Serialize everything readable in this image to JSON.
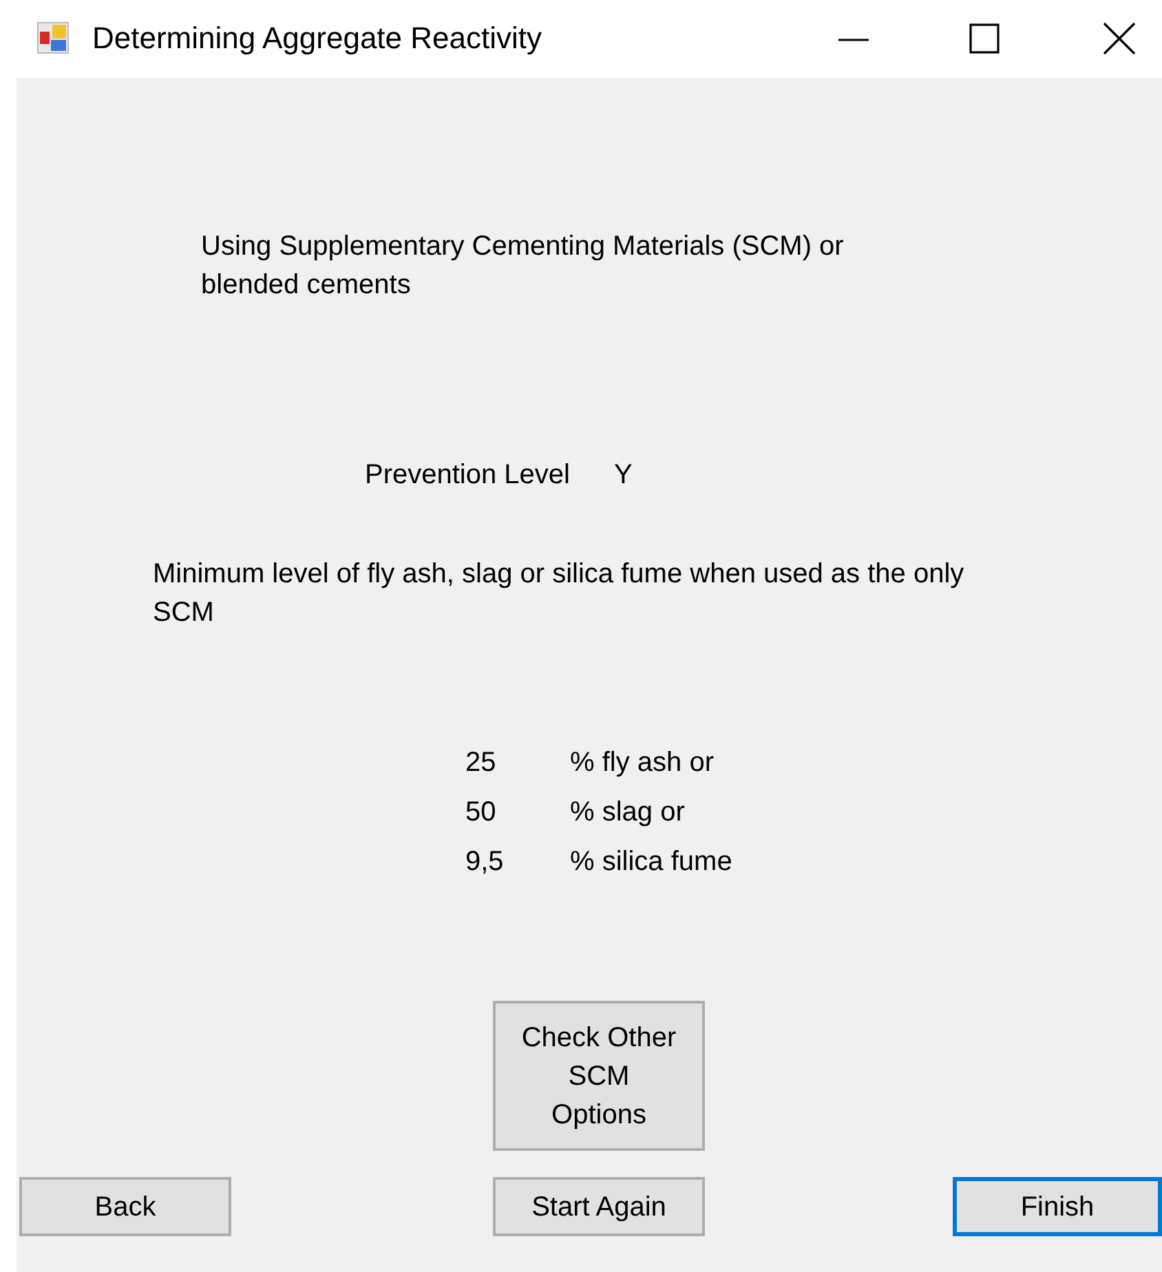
{
  "window": {
    "title": "Determining Aggregate Reactivity"
  },
  "heading": "Using Supplementary Cementing Materials (SCM) or blended cements",
  "prevention": {
    "label": "Prevention Level",
    "value": "Y"
  },
  "note": "Minimum level of fly ash, slag or silica fume when used as the only SCM",
  "minimums": [
    {
      "amount": "25",
      "unit": "% fly ash or"
    },
    {
      "amount": "50",
      "unit": "% slag or"
    },
    {
      "amount": "9,5",
      "unit": "% silica fume"
    }
  ],
  "buttons": [
    {
      "kind": "options",
      "label": "Check Other\nSCM\nOptions",
      "focused": false
    },
    {
      "kind": "nav",
      "label": "Back",
      "focused": false
    },
    {
      "kind": "nav",
      "label": "Start Again",
      "focused": false
    },
    {
      "kind": "nav",
      "label": "Finish",
      "focused": true
    }
  ]
}
